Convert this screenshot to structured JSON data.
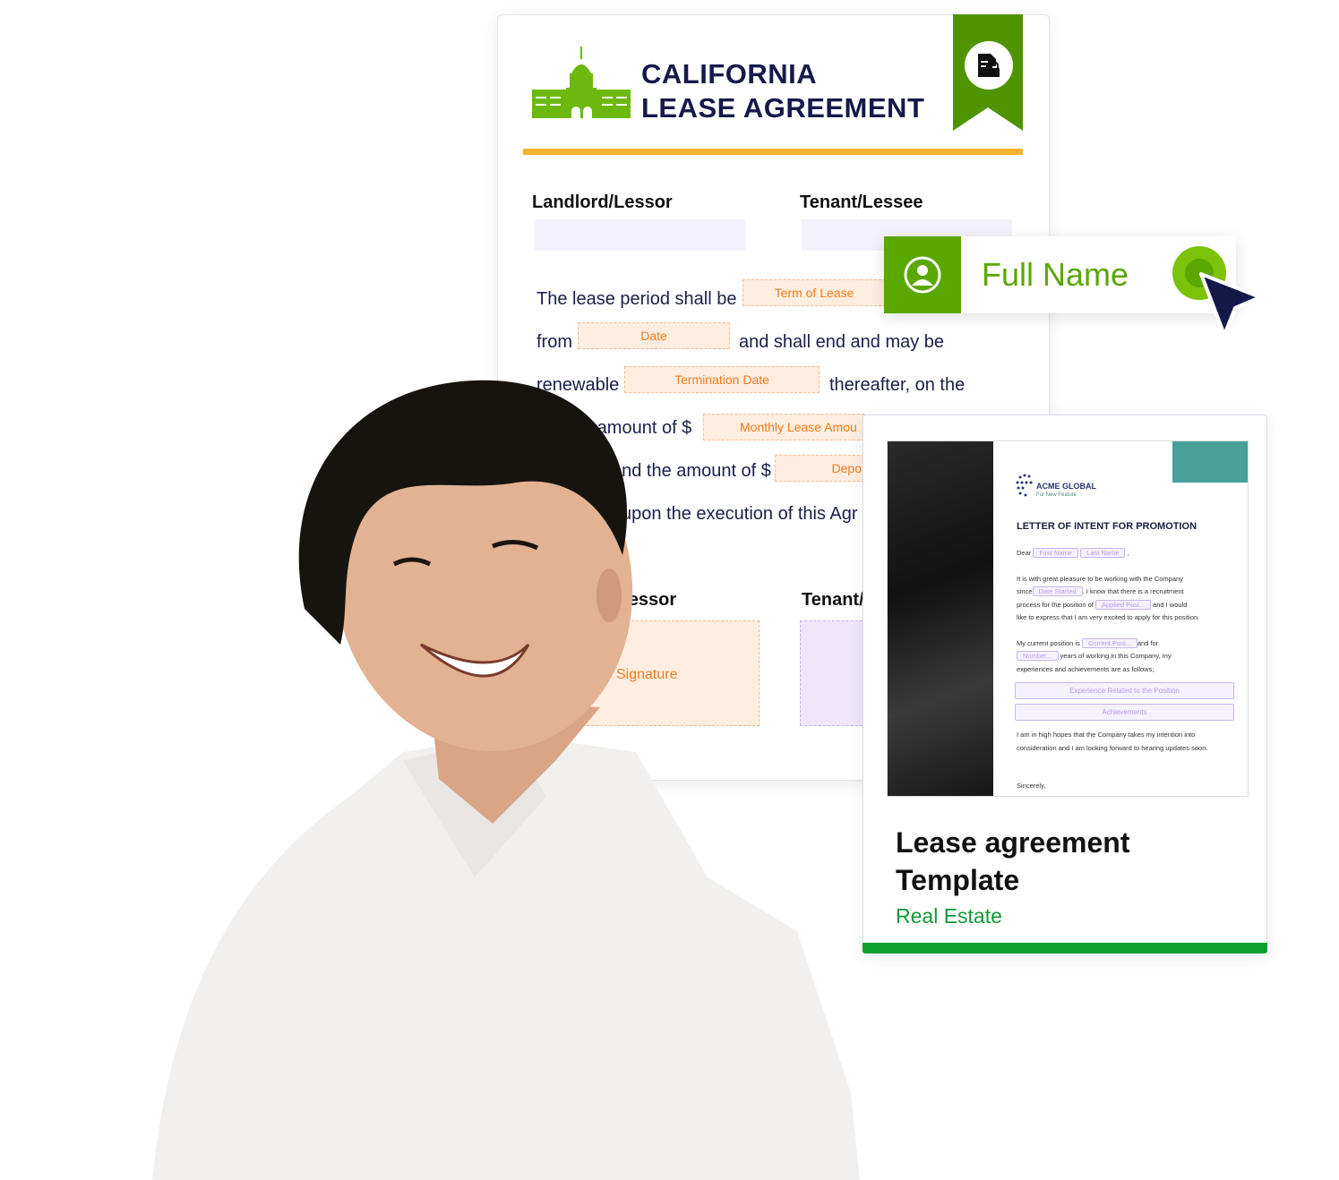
{
  "lease": {
    "title_line1": "CALIFORNIA",
    "title_line2": "LEASE AGREEMENT",
    "badge_icon": "document-lock-icon",
    "landlord_label": "Landlord/Lessor",
    "tenant_label": "Tenant/Lessee",
    "line1": "The lease period shall be",
    "field_term": "Term of Lease",
    "line2a": "from",
    "field_date": "Date",
    "line2b": "and shall end and may be",
    "line3a": "renewable",
    "field_termination": "Termination Date",
    "line3b": "thereafter, on the",
    "line4": "d  amount of $",
    "field_monthly": "Monthly Lease Amou",
    "line5": "and the amount of $",
    "field_deposit": "Depo",
    "line6": "upon the execution of this Agr",
    "sig_label_left": "/Lessor",
    "sig_label_right": "Tenant/",
    "signature": "Signature",
    "colors": {
      "green": "#5aa700",
      "orange": "#fbb12b",
      "navy": "#15194a"
    }
  },
  "full_name_chip": {
    "label": "Full Name",
    "icon": "user-icon",
    "cursor": "cursor-arrow-icon"
  },
  "template_card": {
    "letter": {
      "logo_name": "ACME GLOBAL",
      "logo_sub": "For New Feature",
      "heading": "LETTER OF INTENT FOR PROMOTION",
      "dear": "Dear",
      "first_name": "First Name",
      "last_name": "Last Name",
      "p1a": "It is with great pleasure to be working with the Company",
      "p1b": "since",
      "date_started": "Date Started",
      "p1c": ". I  know that there is a recruitment",
      "p1d": "process for the position of",
      "applied_pos": "Applied Posi...",
      "p1e": "and I would",
      "p1f": "like to express that I am very excited to apply for this position.",
      "p2a": "My current position is",
      "current_pos": "Current Posi...",
      "p2b": "and for",
      "number": "Number...",
      "p2c": "years of working in this Company, my",
      "p2d": "experiences and achievements are as follows;",
      "experience": "Experience Related to the Position",
      "achievements": "Achievements",
      "p3": "I am in high hopes that the Company takes my intention into consideration and I am  looking forward to hearing updates soon.",
      "sincerely": "Sincerely,"
    },
    "title_line1": "Lease agreement",
    "title_line2": "Template",
    "category": "Real Estate"
  }
}
